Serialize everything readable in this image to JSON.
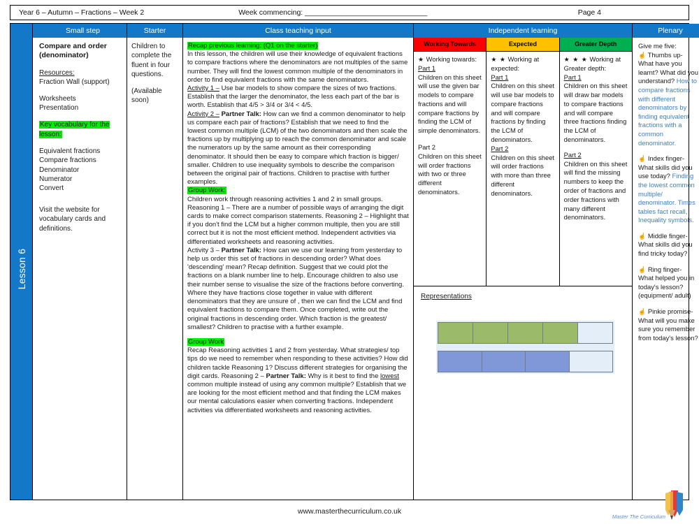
{
  "header": {
    "title": "Year 6 – Autumn – Fractions – Week 2",
    "week_commencing": "Week commencing: ______________________________",
    "page": "Page 4"
  },
  "columns": {
    "small_step": "Small step",
    "starter": "Starter",
    "class_teaching_input": "Class teaching input",
    "independent_learning": "Independent learning",
    "plenary": "Plenary"
  },
  "spine": {
    "label": "Lesson 6"
  },
  "small_step": {
    "title": "Compare and order (denominator)",
    "resources_label": "Resources:",
    "resources": "Fraction Wall (support)",
    "resources_2": "Worksheets\nPresentation",
    "vocab_heading": "Key vocabulary for the lesson:",
    "vocab": [
      "Equivalent fractions",
      "Compare fractions",
      "Denominator",
      "Numerator",
      "Convert"
    ],
    "website_note": "Visit the website for vocabulary cards and definitions."
  },
  "starter": {
    "text": "Children to complete the fluent in four questions.",
    "availability": "(Available soon)"
  },
  "teaching": {
    "recap_heading": "Recap previous learning: (Q1 on the starter)",
    "intro": "In this lesson, the children will use their knowledge of equivalent fractions to compare fractions where the denominators are not multiples of the same number. They will find the lowest common multiple of the denominators in order to find equivalent fractions with the same denominators.",
    "activity1_label": "Activity 1 –",
    "activity1": " Use bar models to show compare the sizes of two fractions. Establish that the larger the denominator, the less each part of the bar is worth. Establish that  4/5 > 3/4 or 3/4 < 4/5.",
    "activity2_label": "Activity 2 –",
    "activity2_bold": "Partner Talk:",
    "activity2": " How can we find a common denominator to help us compare each pair of fractions? Establish that we need to find the lowest common multiple (LCM) of the two denominators and then scale the fractions  up by multiplying up to reach the common denominator and scale the numerators up by the same amount as their corresponding denominator. It should then be easy to compare which fraction is bigger/ smaller. Children to use inequality symbols to describe the comparison between the original pair of fractions. Children to practise with further examples.",
    "group_work_1_heading": "Group Work:",
    "group_work_1": "Children work through reasoning activities 1 and 2 in small groups. Reasoning 1 – There are a number of possible ways of arranging the digit cards to make correct comparison statements. Reasoning 2 – Highlight that if you don't find the LCM but a higher common multiple, then you are still correct but it is not the most efficient method. Independent activities via differentiated worksheets and reasoning activities.",
    "activity3_label": "Activity 3 –",
    "activity3_bold": "Partner Talk:",
    "activity3": " How can we use our learning from yesterday to help us order this set of fractions in descending order? What does 'descending' mean? Recap definition. Suggest that we could plot the fractions on a blank number line to help. Encourage children to also use their number sense to visualise the size of the fractions before converting. Where they have fractions close together in value with different denominators that they are unsure of , then we can find the LCM  and find equivalent fractions to compare them. Once completed, write out the original fractions in descending order. Which fraction is the greatest/ smallest? Children to practise with a further example.",
    "group_work_2_heading": "Group Work",
    "group_work_2a": "Recap Reasoning activities 1 and 2 from yesterday. What strategies/ top tips do we need to remember when responding to these activities?  How did children tackle Reasoning 1? Discuss different strategies for organising the digit cards. Reasoning 2 – ",
    "group_work_2_bold": "Partner  Talk:",
    "group_work_2b": " Why is it best to find the ",
    "group_work_2_underline": "lowest",
    "group_work_2c": " common multiple instead of using any common multiple? Establish that we are looking for the most efficient method  and that finding the LCM makes our mental calculations easier when converting  fractions. Independent activities via differentiated worksheets and reasoning activities."
  },
  "independent": {
    "levels": [
      {
        "heading": "Working Towards",
        "color": "#FF0000",
        "stars": "★",
        "intro": " Working towards:",
        "part1_label": "Part 1",
        "part1": "Children on this sheet will use the given bar models to compare fractions and will compare fractions by finding the LCM of simple denominators.",
        "part2_label": "Part 2",
        "part2": "Children on this sheet will order fractions with two or three different denominators."
      },
      {
        "heading": "Expected",
        "color": "#FFC000",
        "stars": "★ ★",
        "intro": " Working at expected:",
        "part1_label": "Part 1",
        "part1": "Children on this sheet will use bar models to compare fractions and will compare fractions by finding the LCM of denominators.",
        "part2_label": "Part 2",
        "part2": "Children on this sheet will order fractions with more than three different denominators."
      },
      {
        "heading": "Greater Depth",
        "color": "#00B050",
        "stars": "★ ★ ★",
        "intro": " Working at Greater depth:",
        "part1_label": "Part 1",
        "part1": "Children on this sheet will draw bar models to compare fractions and will compare three fractions finding the LCM of denominators.",
        "part2_label": "Part 2",
        "part2": "Children on this sheet will find the missing numbers to keep the order of fractions and order fractions with many different denominators."
      }
    ],
    "representations_title": "Representations"
  },
  "chart_data": {
    "type": "bar",
    "title": "Representations",
    "bars": [
      {
        "label": "4/5",
        "total_parts": 5,
        "shaded_parts": 4,
        "fill_color": "#9BBB6B",
        "empty_color": "#E3EEF9"
      },
      {
        "label": "3/4",
        "total_parts": 4,
        "shaded_parts": 3,
        "fill_color": "#8098D8",
        "empty_color": "#E3EEF9"
      }
    ]
  },
  "plenary": {
    "title": "Give me five:",
    "items": [
      {
        "icon": "☝",
        "question": " Thumbs up- What have you learnt? What did you understand?",
        "answer": "How to compare fractions with different denominators by finding equivalent fractions with a common denominator."
      },
      {
        "icon": "☝",
        "question": " Index finger- What skills did you use today?",
        "answer": "Finding the lowest common multiple/ denominator. Times tables fact recall, Inequality symbols."
      },
      {
        "icon": "☝",
        "question": " Middle finger- What skills did you find tricky today?",
        "answer": ""
      },
      {
        "icon": "☝",
        "question": " Ring finger- What helped you in today's lesson? (equipment/ adult)",
        "answer": ""
      },
      {
        "icon": "☝",
        "question": " Pinkie promise- What will you make sure you remember from today's lesson?",
        "answer": ""
      }
    ]
  },
  "footer": {
    "url": "www.masterthecurriculum.co.uk",
    "logo_text": "Master  The  Curriculum"
  }
}
